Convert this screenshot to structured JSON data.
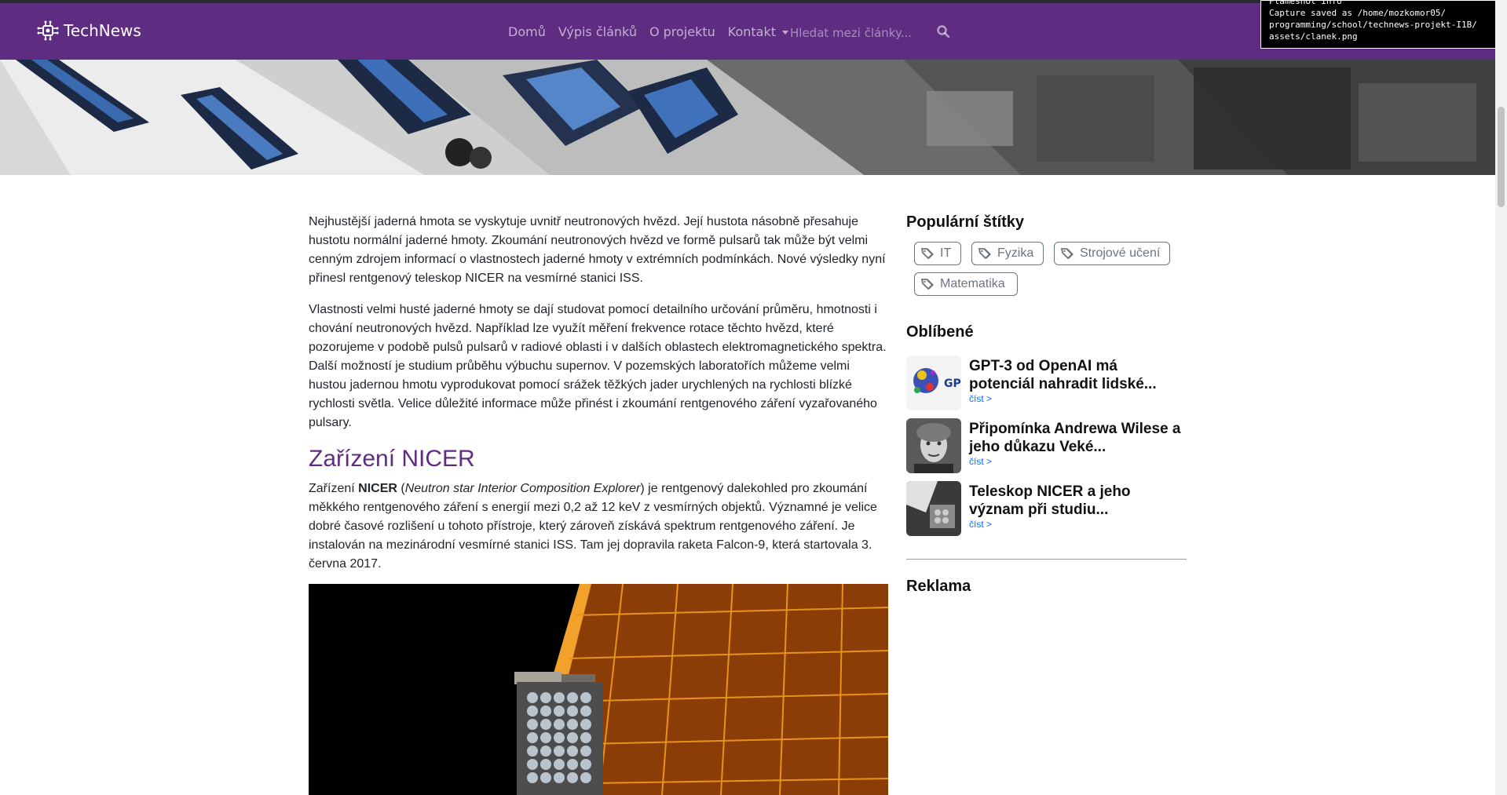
{
  "brand": {
    "name": "TechNews",
    "icon": "circuit-icon"
  },
  "nav": {
    "links": [
      "Domů",
      "Výpis článků",
      "O projektu"
    ],
    "dropdown_label": "Kontakt",
    "search_placeholder": "Hledat mezi články...",
    "search_icon": "search-icon"
  },
  "tooltip": {
    "line1": "Flameshot Info",
    "line2": "Capture saved as /home/mozkomor05/",
    "line3": "programming/school/technews-projekt-I1B/",
    "line4": "assets/clanek.png"
  },
  "article": {
    "paragraph1": "Nejhustější jaderná hmota se vyskytuje uvnitř neutronových hvězd. Její hustota násobně přesahuje hustotu normální jaderné hmoty. Zkoumání neutronových hvězd ve formě pulsarů tak může být velmi cenným zdrojem informací o vlastnostech jaderné hmoty v extrémních podmínkách. Nové výsledky nyní přinesl rentgenový teleskop NICER na vesmírné stanici ISS.",
    "paragraph2": "Vlastnosti velmi husté jaderné hmoty se dají studovat pomocí detailního určování průměru, hmotnosti i chování neutronových hvězd. Například lze využít měření frekvence rotace těchto hvězd, které pozorujeme v podobě pulsů pulsarů v radiové oblasti i v dalších oblastech elektromagnetického spektra. Další možností je studium průběhu výbuchu supernov. V pozemských laboratořích můžeme velmi hustou jadernou hmotu vyprodukovat pomocí srážek těžkých jader urychlených na rychlosti blízké rychlosti světla. Velice důležité informace může přinést i zkoumání rentgenového záření vyzařovaného pulsary.",
    "heading": "Zařízení NICER",
    "p3_start": "Zařízení ",
    "p3_bold": "NICER",
    "p3_open": " (",
    "p3_italic": "Neutron star Interior Composition Explorer",
    "p3_rest": ") je rentgenový dalekohled pro zkoumání měkkého rentgenového záření s energií mezi 0,2 až 12 keV z vesmírných objektů. Významné je velice dobré časové rozlišení u tohoto přístroje, který zároveň získává spektrum rentgenového záření. Je instalován na mezinárodní vesmírné stanici ISS. Tam jej dopravila raketa Falcon-9, která startovala 3. června 2017."
  },
  "sidebar": {
    "tags_heading": "Populární štítky",
    "tags": [
      "IT",
      "Fyzika",
      "Strojové učení",
      "Matematika"
    ],
    "tag_icon": "tags-icon",
    "favorites_heading": "Oblíbené",
    "favorites": [
      {
        "title": "GPT-3 od OpenAI má potenciál nahradit lidské...",
        "link": "číst >"
      },
      {
        "title": "Připomínka Andrewa Wilese a jeho důkazu Veké...",
        "link": "číst >"
      },
      {
        "title": "Teleskop NICER a jeho význam při studiu...",
        "link": "číst >"
      }
    ],
    "ads_heading": "Reklama"
  },
  "colors": {
    "navbar": "#5e2d82",
    "heading": "#5e2d82",
    "link": "#0d6efd",
    "tag_border": "#6c757d"
  }
}
